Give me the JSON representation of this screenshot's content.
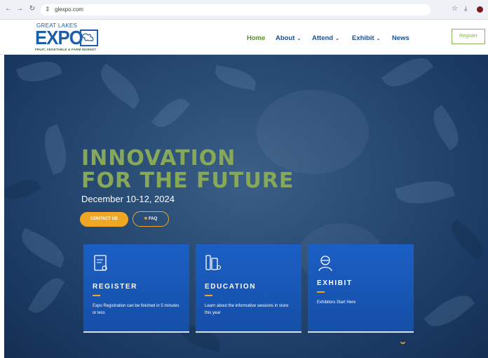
{
  "browser": {
    "url": "glexpo.com"
  },
  "logo": {
    "top_text": "GREAT LAKES",
    "main_text": "EXPO",
    "sub_text": "FRUIT, VEGETABLE & FARM MARKET"
  },
  "nav": {
    "items": [
      {
        "label": "Home",
        "dropdown": false,
        "active": true
      },
      {
        "label": "About",
        "dropdown": true
      },
      {
        "label": "Attend",
        "dropdown": true
      },
      {
        "label": "Exhibit",
        "dropdown": true
      },
      {
        "label": "News",
        "dropdown": false
      }
    ],
    "register_label": "Register"
  },
  "hero": {
    "headline_line1": "INNOVATION",
    "headline_line2": "FOR THE FUTURE",
    "date": "December 10-12, 2024",
    "contact_label": "CONTACT US",
    "faq_label": "FAQ"
  },
  "cards": [
    {
      "title": "REGISTER",
      "description": "Expo Registration can be finished in 5 minutes or less",
      "icon": "document-certificate-icon"
    },
    {
      "title": "EDUCATION",
      "description": "Learn about the informative sessions in store this year",
      "icon": "notebook-pencil-icon"
    },
    {
      "title": "EXHIBIT",
      "description": "Exhibitors Start Here",
      "icon": "exhibitor-person-icon"
    }
  ],
  "colors": {
    "accent_green": "#87a857",
    "accent_orange": "#f0a726",
    "nav_blue": "#1d4f8f",
    "card_blue": "#1b5fc4"
  }
}
